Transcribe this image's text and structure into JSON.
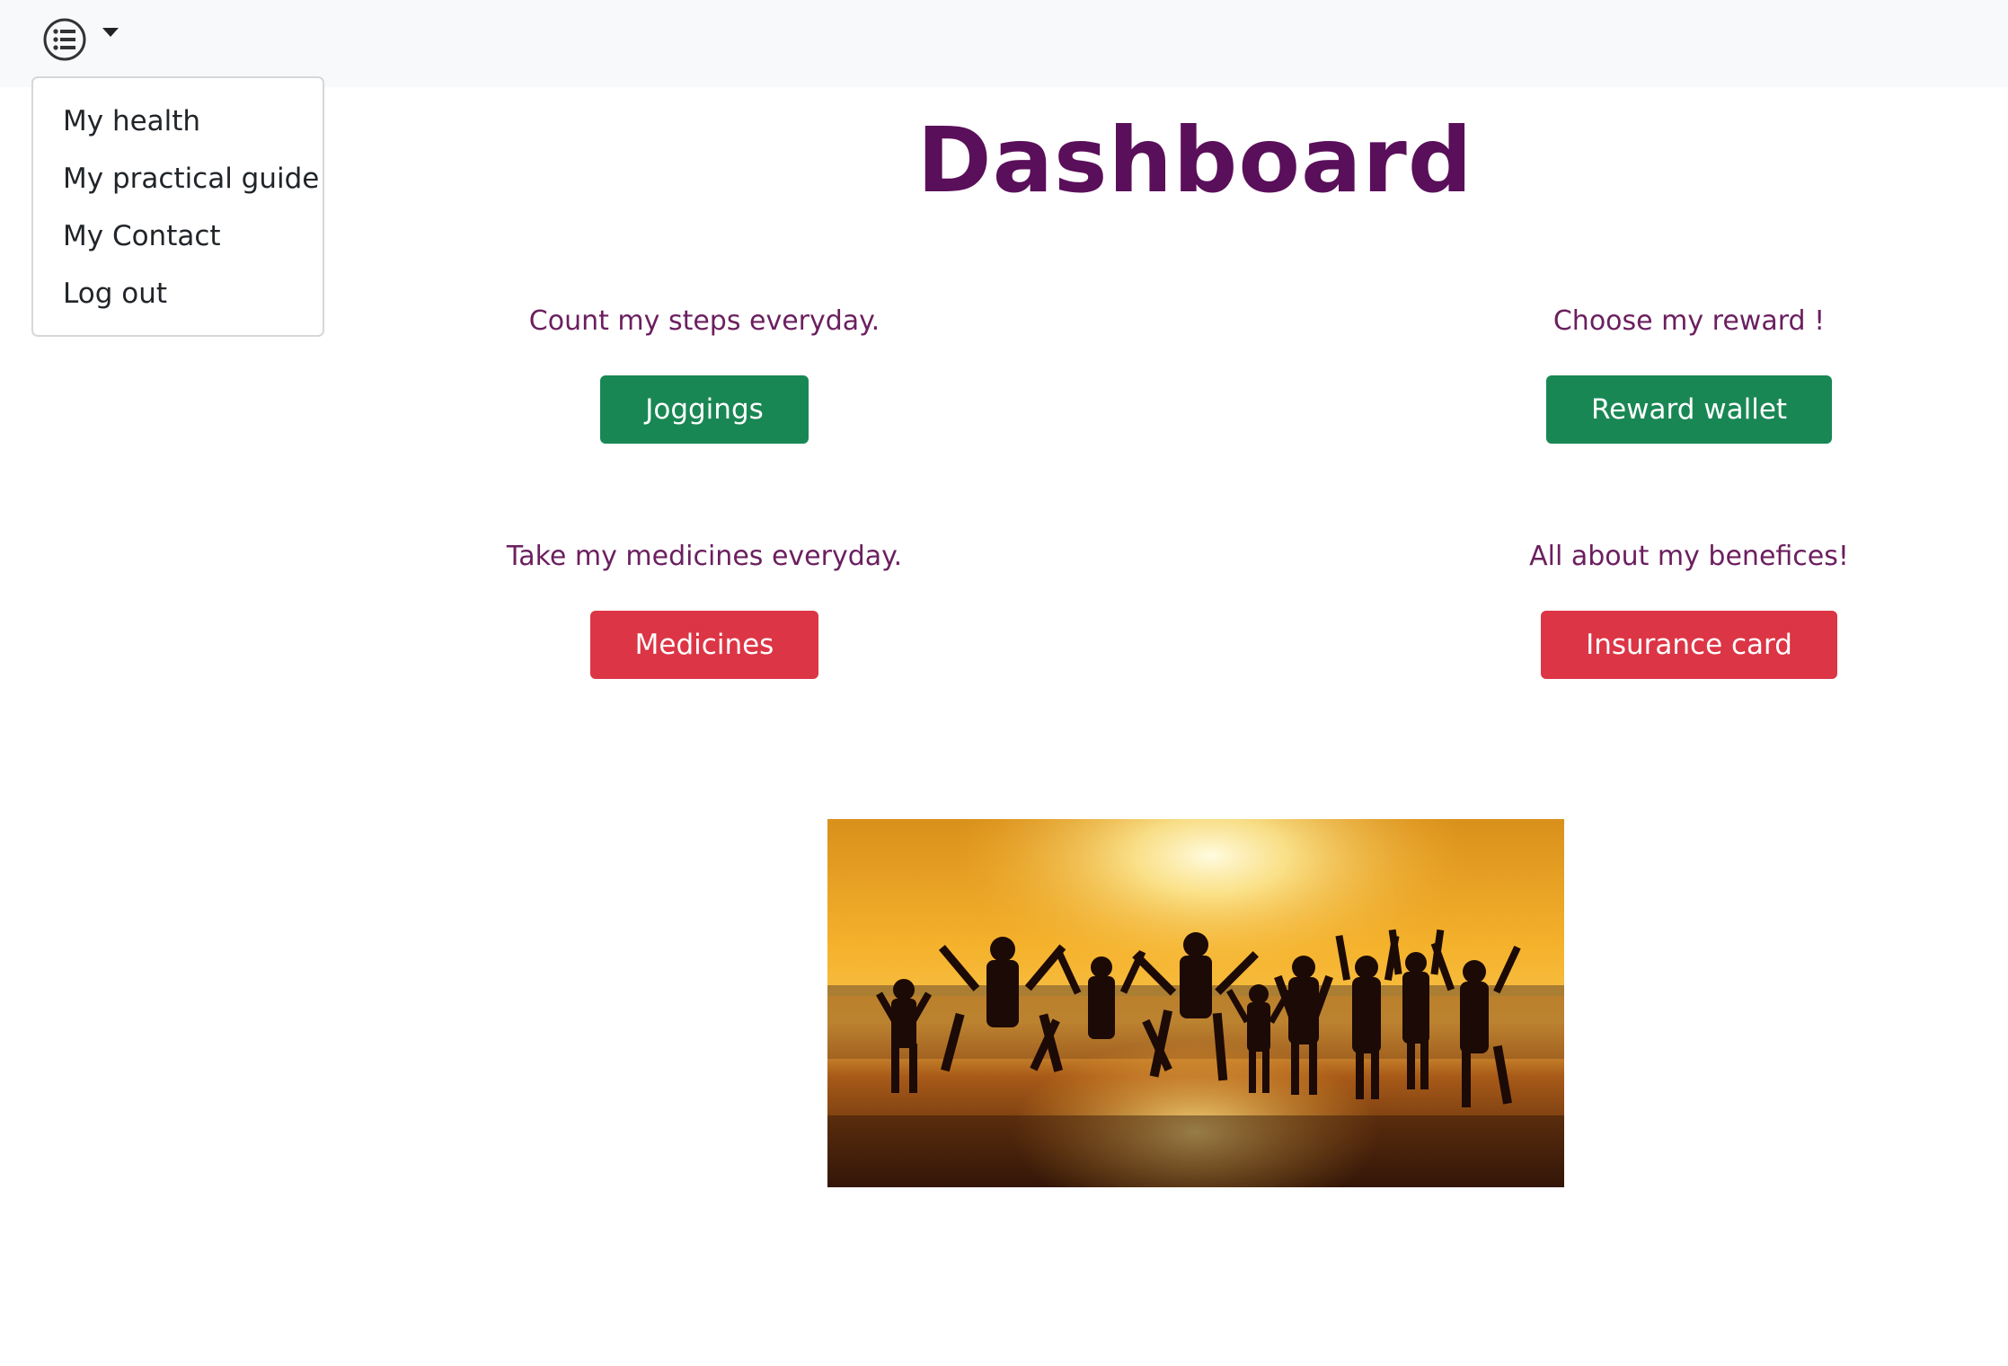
{
  "nav": {
    "menu_icon": "list-icon",
    "dropdown": [
      {
        "label": "My health"
      },
      {
        "label": "My practical guide"
      },
      {
        "label": "My Contact"
      },
      {
        "label": "Log out"
      }
    ]
  },
  "main": {
    "title": "Dashboard",
    "blocks": [
      {
        "caption": "Count my steps everyday.",
        "button": "Joggings"
      },
      {
        "caption": "Choose my reward !",
        "button": "Reward wallet"
      },
      {
        "caption": "Take my medicines everyday.",
        "button": "Medicines"
      },
      {
        "caption": "All about my benefices!",
        "button": "Insurance card"
      }
    ]
  },
  "colors": {
    "title": "#5a0f5a",
    "caption": "#6b1f5f",
    "green_button": "#198754",
    "red_button": "#dc3545"
  }
}
